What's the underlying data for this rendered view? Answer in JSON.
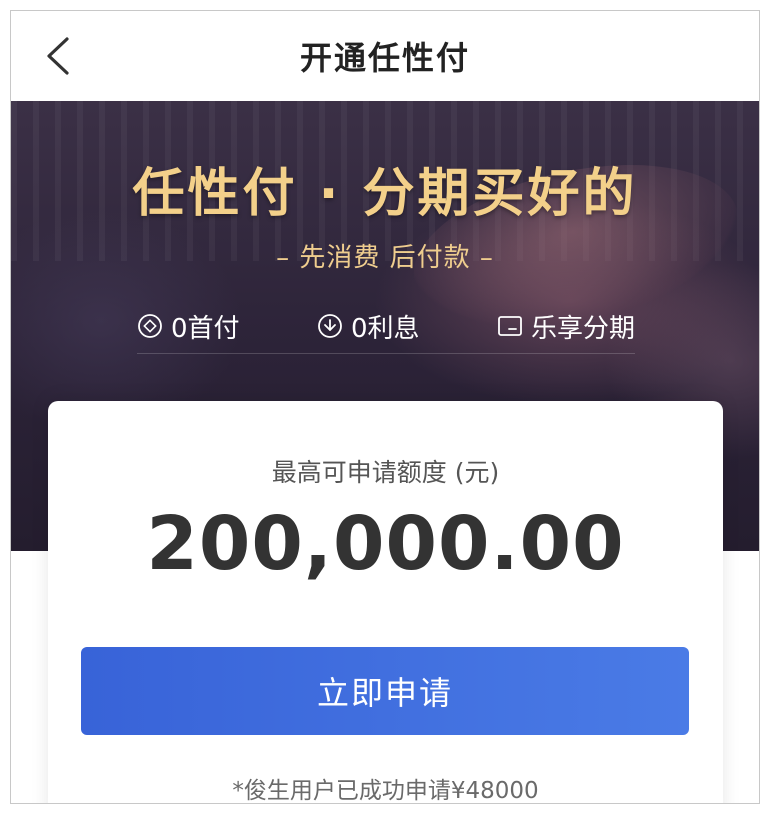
{
  "header": {
    "title": "开通任性付"
  },
  "hero": {
    "headline": "任性付 · 分期买好的",
    "subtitle": "– 先消费 后付款 –",
    "features": [
      {
        "icon": "coin-circle-icon",
        "label": "0首付"
      },
      {
        "icon": "down-arrow-circle-icon",
        "label": "0利息"
      },
      {
        "icon": "card-icon",
        "label": "乐享分期"
      }
    ]
  },
  "card": {
    "label": "最高可申请额度 (元)",
    "amount": "200,000.00",
    "apply_label": "立即申请",
    "note": "*俊生用户已成功申请¥48000"
  },
  "colors": {
    "accent_gold": "#f3d08a",
    "button_blue": "#3863d8",
    "hero_dark": "#2c2338"
  }
}
